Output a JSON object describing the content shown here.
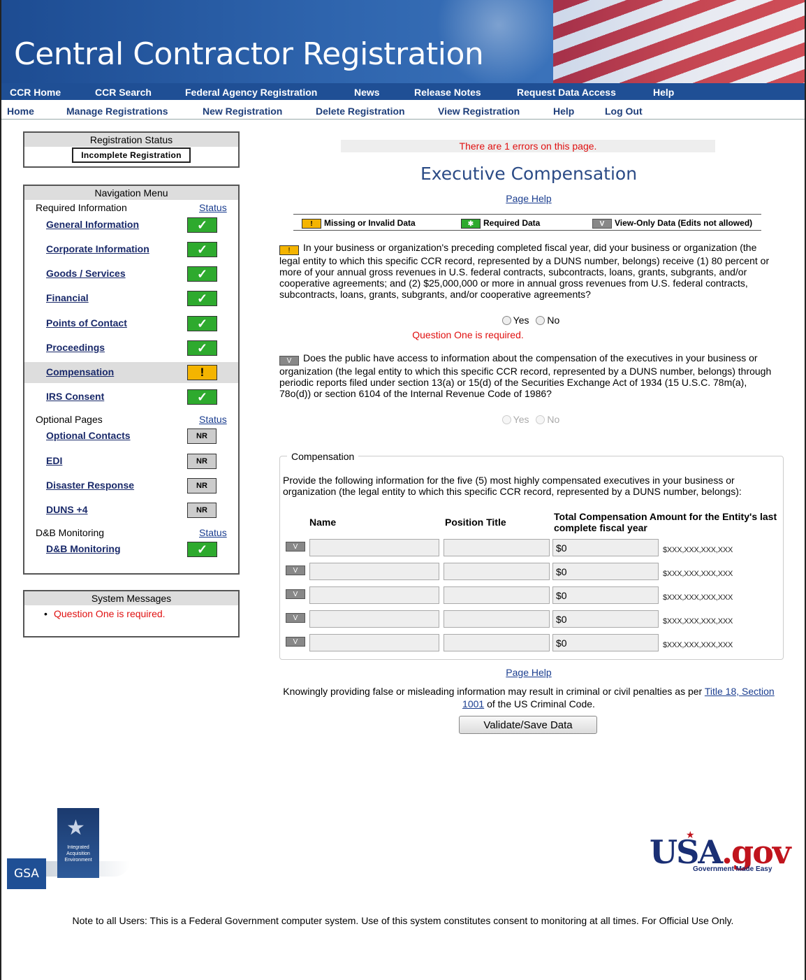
{
  "header": {
    "site_title": "Central Contractor Registration"
  },
  "top_nav": [
    "CCR Home",
    "CCR Search",
    "Federal Agency Registration",
    "News",
    "Release Notes",
    "Request Data Access",
    "Help"
  ],
  "sub_nav": [
    "Home",
    "Manage Registrations",
    "New Registration",
    "Delete Registration",
    "View Registration",
    "Help",
    "Log Out"
  ],
  "registration_status": {
    "title": "Registration Status",
    "value": "Incomplete Registration"
  },
  "nav_menu": {
    "title": "Navigation Menu",
    "groups": [
      {
        "label": "Required Information",
        "status_label": "Status",
        "items": [
          {
            "label": "General Information",
            "status": "complete"
          },
          {
            "label": "Corporate Information",
            "status": "complete"
          },
          {
            "label": "Goods / Services",
            "status": "complete"
          },
          {
            "label": "Financial",
            "status": "complete"
          },
          {
            "label": "Points of Contact",
            "status": "complete"
          },
          {
            "label": "Proceedings",
            "status": "complete"
          },
          {
            "label": "Compensation",
            "status": "error"
          },
          {
            "label": "IRS Consent",
            "status": "complete"
          }
        ]
      },
      {
        "label": "Optional Pages",
        "status_label": "Status",
        "items": [
          {
            "label": "Optional Contacts",
            "status": "NR"
          },
          {
            "label": "EDI",
            "status": "NR"
          },
          {
            "label": "Disaster Response",
            "status": "NR"
          },
          {
            "label": "DUNS +4",
            "status": "NR"
          }
        ]
      },
      {
        "label": "D&B Monitoring",
        "status_label": "Status",
        "items": [
          {
            "label": "D&B Monitoring",
            "status": "complete"
          }
        ]
      }
    ]
  },
  "system_messages": {
    "title": "System Messages",
    "items": [
      "Question One is required."
    ]
  },
  "main": {
    "error_banner": "There are 1 errors on this page.",
    "title": "Executive Compensation",
    "page_help": "Page Help",
    "legend": {
      "missing": "Missing or Invalid Data",
      "required": "Required Data",
      "view_only": "View-Only Data (Edits not allowed)"
    },
    "question1": "In your business or organization's preceding completed fiscal year, did your business or organization (the legal entity to which this specific CCR record, represented by a DUNS number, belongs) receive (1) 80 percent or more of your annual gross revenues in U.S. federal contracts, subcontracts, loans, grants, subgrants, and/or cooperative agreements; and (2) $25,000,000 or more in annual gross revenues from U.S. federal contracts, subcontracts, loans, grants, subgrants, and/or cooperative agreements?",
    "question1_error": "Question One is required.",
    "question2": "Does the public have access to information about the compensation of the executives in your business or organization (the legal entity to which this specific CCR record, represented by a DUNS number, belongs) through periodic reports filed under section 13(a) or 15(d) of the Securities Exchange Act of 1934 (15 U.S.C. 78m(a), 78o(d)) or section 6104 of the Internal Revenue Code of 1986?",
    "yes_label": "Yes",
    "no_label": "No",
    "compensation": {
      "legend": "Compensation",
      "description": "Provide the following information for the five (5) most highly compensated executives in your business or organization (the legal entity to which this specific CCR record, represented by a DUNS number, belongs):",
      "col_name": "Name",
      "col_position": "Position Title",
      "col_amount": "Total Compensation Amount for the Entity's last complete fiscal year",
      "amount_format": "$XXX,XXX,XXX,XXX",
      "rows": [
        {
          "name": "",
          "position": "",
          "amount": "$0"
        },
        {
          "name": "",
          "position": "",
          "amount": "$0"
        },
        {
          "name": "",
          "position": "",
          "amount": "$0"
        },
        {
          "name": "",
          "position": "",
          "amount": "$0"
        },
        {
          "name": "",
          "position": "",
          "amount": "$0"
        }
      ]
    },
    "disclaimer_pre": "Knowingly providing false or misleading information may result in criminal or civil penalties as per ",
    "disclaimer_link": "Title 18, Section 1001",
    "disclaimer_post": " of the US Criminal Code.",
    "save_button": "Validate/Save Data"
  },
  "logos": {
    "gsa": "GSA",
    "iae": "Integrated Acquisition Environment",
    "usa_main": "USA",
    "usa_gov": ".gov",
    "usa_tagline": "Government Made Easy"
  },
  "footer_note": "Note to all Users: This is a Federal Government computer system. Use of this system constitutes consent to monitoring at all times. For Official Use Only.",
  "colors": {
    "brand_blue": "#1f4f95",
    "error_red": "#e01010",
    "ok_green": "#2eaa2e",
    "warn_yellow": "#f4b400"
  }
}
